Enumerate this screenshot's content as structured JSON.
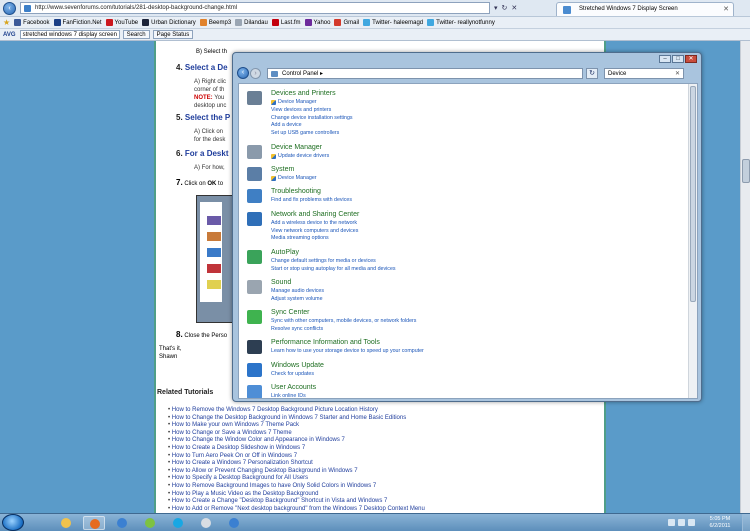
{
  "browser": {
    "url": "http://www.sevenforums.com/tutorials/281-desktop-background-change.html",
    "tab_title": "Stretched Windows 7 Display Screen",
    "favorites": [
      {
        "label": "Facebook",
        "color": "#3b5998"
      },
      {
        "label": "FanFiction.Net",
        "color": "#1b3f86"
      },
      {
        "label": "YouTube",
        "color": "#cc181e"
      },
      {
        "label": "Urban Dictionary",
        "color": "#1d2439"
      },
      {
        "label": "Beemp3",
        "color": "#e0822c"
      },
      {
        "label": "Dilandau",
        "color": "#9aa6b4"
      },
      {
        "label": "Last.fm",
        "color": "#c3000d"
      },
      {
        "label": "Yahoo",
        "color": "#6d2b9c"
      },
      {
        "label": "Gmail",
        "color": "#d33a2c"
      },
      {
        "label": "Twitter- haleemagd",
        "color": "#40a8e0"
      },
      {
        "label": "Twitter- reallynotfunny",
        "color": "#40a8e0"
      }
    ],
    "toolbar": {
      "avg": "AVG",
      "search_value": "stretched windows 7 display screen",
      "search_button": "Search",
      "page_status": "Page Status"
    }
  },
  "page": {
    "step_b": "B) Select th",
    "step4": {
      "num": "4.",
      "title": "Select a De"
    },
    "step4_text": [
      "A) Right  clic",
      "corner of th"
    ],
    "step4_note_label": "NOTE:",
    "step4_note_text": "You",
    "step4_note_text2": "desktop unc",
    "step5": {
      "num": "5.",
      "title": "Select the P"
    },
    "step5_text": [
      "A) Click on",
      "for the desk"
    ],
    "step6": {
      "num": "6.",
      "title": "For a Deskt"
    },
    "step6_text": "A) For how,",
    "step7": {
      "num": "7.",
      "text": "Click on",
      "bold": "OK",
      "rest": "to"
    },
    "step8": {
      "num": "8.",
      "text": "Close the Perso"
    },
    "signature": [
      "That's it,",
      "Shawn"
    ],
    "related_heading": "Related Tutorials",
    "related": [
      "How to Remove the Windows 7 Desktop Background Picture Location History",
      "How to Change the Desktop Background in Windows 7 Starter and Home Basic Editions",
      "How to Make your own Windows 7 Theme Pack",
      "How to Change or Save a Windows 7 Theme",
      "How to Change the Window Color and Appearance in Windows 7",
      "How to Create a Desktop Slideshow in Windows 7",
      "How to Turn Aero Peek On or Off in Windows 7",
      "How to Create a Windows 7 Personalization Shortcut",
      "How to Allow or Prevent Changing Desktop Background in Windows 7",
      "How to Specify a Desktop Background for All Users",
      "How to Remove Background Images to have Only Solid Colors in Windows 7",
      "How to Play a Music Video as the Desktop Background",
      "How to Create a Change \"Desktop Background\" Shortcut in Vista and Windows 7",
      "How to Add or Remove \"Next desktop background\" from the Windows 7 Desktop Context Menu"
    ]
  },
  "control_panel": {
    "breadcrumb": "Control Panel",
    "search_value": "Device",
    "categories": [
      {
        "title": "Devices and Printers",
        "icon_color": "#6a7f95",
        "links": [
          "Device Manager",
          "View devices and printers",
          "Change device installation settings",
          "Add a device",
          "Set up USB game controllers"
        ],
        "shield": [
          0
        ]
      },
      {
        "title": "Device Manager",
        "icon_color": "#8a9aab",
        "links": [
          "Update device drivers"
        ],
        "shield": [
          0
        ]
      },
      {
        "title": "System",
        "icon_color": "#5b7ea6",
        "links": [
          "Device Manager"
        ],
        "shield": [
          0
        ]
      },
      {
        "title": "Troubleshooting",
        "icon_color": "#3f7fc4",
        "links": [
          "Find and fix problems with devices"
        ],
        "shield": []
      },
      {
        "title": "Network and Sharing Center",
        "icon_color": "#2f6fb8",
        "links": [
          "Add a wireless device to the network",
          "View network computers and devices",
          "Media streaming options"
        ],
        "shield": []
      },
      {
        "title": "AutoPlay",
        "icon_color": "#3aa35a",
        "links": [
          "Change default settings for media or devices",
          "Start or stop using autoplay for all media and devices"
        ],
        "shield": []
      },
      {
        "title": "Sound",
        "icon_color": "#9aa5b0",
        "links": [
          "Manage audio devices",
          "Adjust system volume"
        ],
        "shield": []
      },
      {
        "title": "Sync Center",
        "icon_color": "#3fb34f",
        "links": [
          "Sync with other computers, mobile devices, or network folders",
          "Resolve sync conflicts"
        ],
        "shield": []
      },
      {
        "title": "Performance Information and Tools",
        "icon_color": "#2d3e52",
        "links": [
          "Learn how to use your storage device to speed up your computer"
        ],
        "shield": []
      },
      {
        "title": "Windows Update",
        "icon_color": "#2c74c9",
        "links": [
          "Check for updates"
        ],
        "shield": []
      },
      {
        "title": "User Accounts",
        "icon_color": "#4e8ed6",
        "links": [
          "Link online IDs"
        ],
        "shield": []
      }
    ]
  },
  "taskbar": {
    "apps": [
      {
        "name": "explorer",
        "color": "#f1c24c",
        "active": false
      },
      {
        "name": "firefox",
        "color": "#e66b1f",
        "active": true
      },
      {
        "name": "itunes",
        "color": "#3b80d1",
        "active": false
      },
      {
        "name": "windows-live",
        "color": "#7dc242",
        "active": false
      },
      {
        "name": "skype",
        "color": "#19a7e3",
        "active": false
      },
      {
        "name": "notes",
        "color": "#d8dde3",
        "active": false
      },
      {
        "name": "itunes",
        "color": "#3b80d1",
        "active": false
      }
    ],
    "time": "5:05 PM",
    "date": "6/2/2011"
  }
}
